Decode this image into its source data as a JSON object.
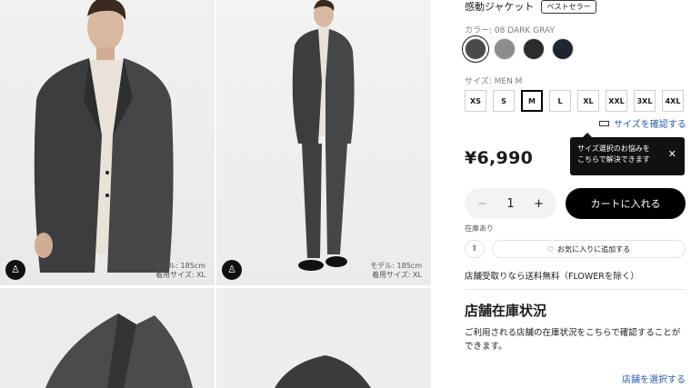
{
  "product": {
    "name": "感動ジャケット",
    "badge": "ベストセラー",
    "color_label": "カラー: 08 DARK GRAY",
    "colors": [
      {
        "name": "dark-gray",
        "hex": "#4a4a4a",
        "selected": true
      },
      {
        "name": "gray",
        "hex": "#8d8d8d",
        "selected": false
      },
      {
        "name": "black",
        "hex": "#2c2c2c",
        "selected": false
      },
      {
        "name": "navy",
        "hex": "#1e2530",
        "selected": false
      }
    ],
    "size_label": "サイズ: MEN M",
    "sizes": [
      "XS",
      "S",
      "M",
      "L",
      "XL",
      "XXL",
      "3XL",
      "4XL"
    ],
    "selected_size": "M",
    "size_check_link": "サイズを確認する",
    "price": "¥6,990"
  },
  "tooltip": {
    "line1": "サイズ選択のお悩みを",
    "line2": "こちらで解決できます",
    "close": "✕"
  },
  "purchase": {
    "qty_minus": "−",
    "qty_value": "1",
    "qty_plus": "+",
    "cart_button": "カートに入れる",
    "stock_status": "在庫あり",
    "share_icon": "⇪",
    "favorite_icon": "♡",
    "favorite_button": "お気に入りに追加する",
    "shipping_note": "店舗受取りなら送料無料（FLOWERを除く）"
  },
  "store": {
    "title": "店舗在庫状況",
    "description": "ご利用される店舗の在庫状況をこちらで確認することができます。",
    "link": "店舗を選択する"
  },
  "gallery": {
    "hanger_icon": "♙",
    "photo1_model_line1": "モデル: 185cm",
    "photo1_model_line2": "着用サイズ: XL",
    "photo2_model_line1": "モデル: 185cm",
    "photo2_model_line2": "着用サイズ: XL"
  }
}
